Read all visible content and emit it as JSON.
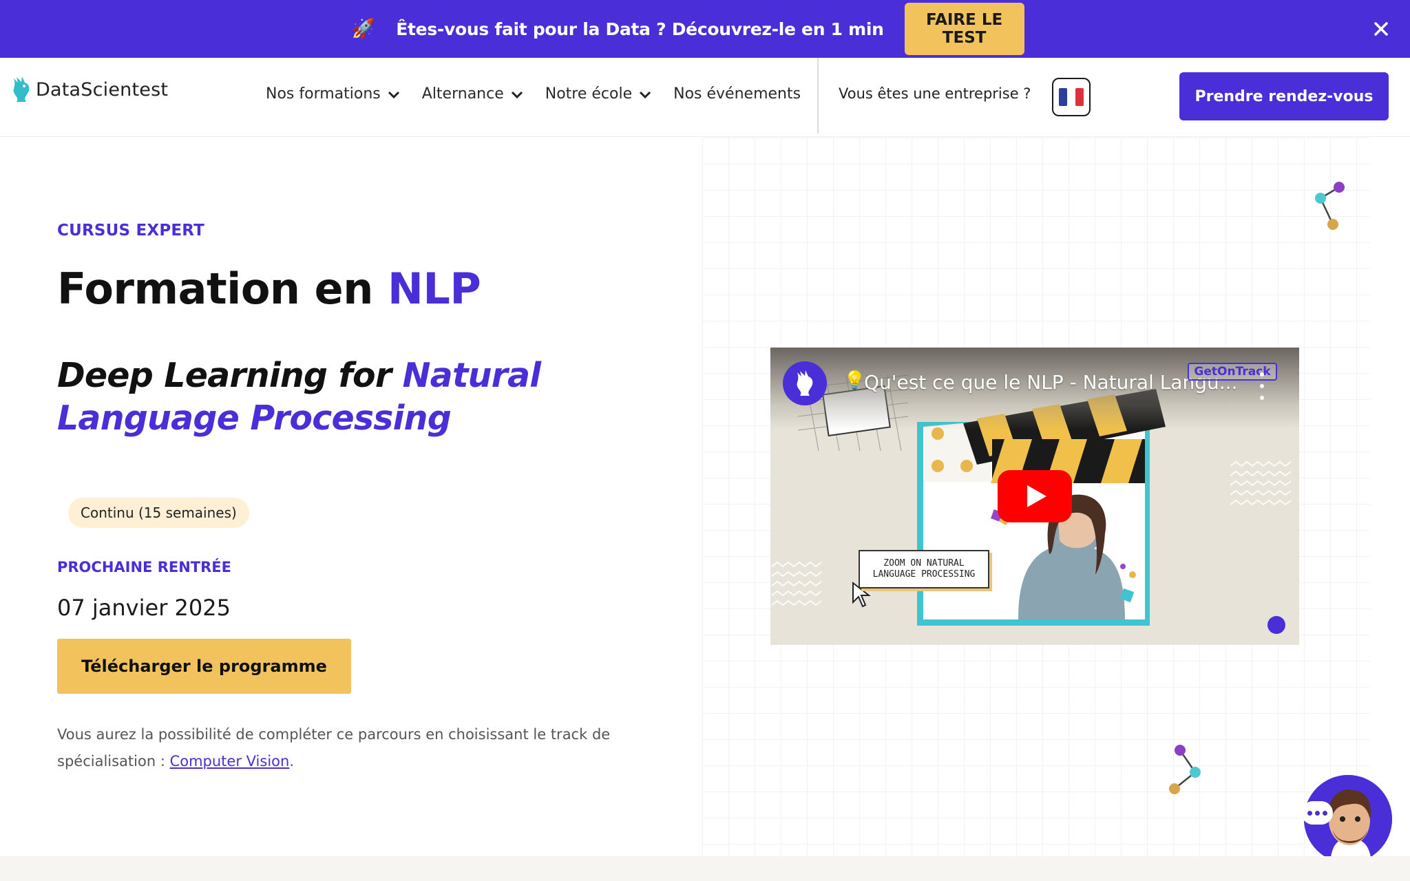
{
  "banner": {
    "emoji": "🚀",
    "text": "Êtes-vous fait pour la Data ? Découvrez-le en 1 min",
    "button": "FAIRE LE TEST"
  },
  "header": {
    "logo_text": "DataScientest",
    "nav": [
      {
        "label": "Nos formations",
        "has_dropdown": true
      },
      {
        "label": "Alternance",
        "has_dropdown": true
      },
      {
        "label": "Notre école",
        "has_dropdown": true
      },
      {
        "label": "Nos événements",
        "has_dropdown": false
      }
    ],
    "enterprise_link": "Vous êtes une entreprise ?",
    "language": "fr-flag-icon",
    "cta": "Prendre rendez-vous"
  },
  "hero": {
    "eyebrow": "CURSUS EXPERT",
    "title_prefix": "Formation en ",
    "title_accent": "NLP",
    "subtitle_prefix": "Deep Learning for ",
    "subtitle_accent": "Natural Language Processing",
    "pill": "Continu (15 semaines)",
    "next_label": "PROCHAINE RENTRÉE",
    "next_date": "07 janvier 2025",
    "download_button": "Télécharger le programme",
    "note_text": "Vous aurez la possibilité de compléter ce parcours en choisissant le track de spécialisation : ",
    "note_link": "Computer Vision",
    "note_end": "."
  },
  "video": {
    "title": "Qu'est ce que le NLP - Natural Langu...",
    "bulb": "💡",
    "badge": "GetOnTrack",
    "card_line1": "ZOOM ON NATURAL",
    "card_line2": "LANGUAGE PROCESSING"
  },
  "colors": {
    "brand_purple": "#4a2ed8",
    "accent_yellow": "#f2c35c",
    "pill_bg": "#fdf0d5"
  }
}
